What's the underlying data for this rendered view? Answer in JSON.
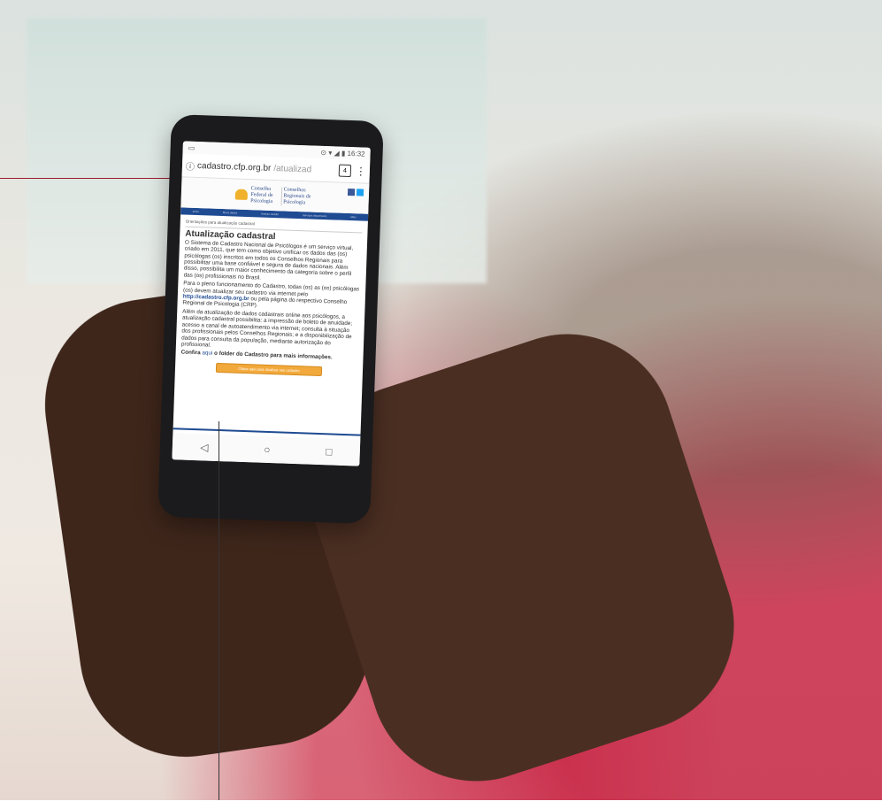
{
  "statusbar": {
    "time": "16:32",
    "icons": "⊙ ▾ ◢ ▮"
  },
  "browser": {
    "url_host": "cadastro.cfp.org.br",
    "url_path": "/atualizad",
    "tab_count": "4"
  },
  "site": {
    "logo_left": "Conselho Federal de Psicologia",
    "logo_right": "Conselhos Regionais de Psicologia",
    "nav_items": [
      "Início",
      "Meus dados",
      "Acesso restrito",
      "Serviços disponíveis",
      "Mais"
    ],
    "breadcrumb": "Orientações para atualização cadastral",
    "title": "Atualização cadastral",
    "p1": "O Sistema de Cadastro Nacional de Psicólogos é um serviço virtual, criado em 2011, que tem como objetivo unificar os dados das (os) psicólogas (os) inscritos em todos os Conselhos Regionais para possibilitar uma base confiável e segura de dados nacionais. Além disso, possibilita um maior conhecimento da categoria sobre o perfil das (os) profissionais no Brasil.",
    "p2_start": "Para o pleno funcionamento do Cadastro, todas (os) as (os) psicólogas (os) devem atualizar seu cadastro via internet pelo ",
    "p2_link": "http://cadastro.cfp.org.br",
    "p2_end": " ou pela página do respectivo Conselho Regional de Psicologia (CRP).",
    "p3": "Além da atualização de dados cadastrais online aos psicólogos, a atualização cadastral possibilita: a impressão de boleto de anuidade; acesso a canal de autoatendimento via internet; consulta à situação dos profissionais pelos Conselhos Regionais; e a disponibilização de dados para consulta da população, mediante autorização do profissional.",
    "p4_start": "Confira ",
    "p4_link": "aqui",
    "p4_end": " o folder do Cadastro para mais informações.",
    "cta_label": "Clique aqui para atualizar seu cadastro"
  },
  "android_nav": {
    "back": "◁",
    "home": "○",
    "recent": "□"
  },
  "colors": {
    "accent": "#1f4b92",
    "cta": "#f2a93b",
    "callout": "#9b1b30"
  }
}
